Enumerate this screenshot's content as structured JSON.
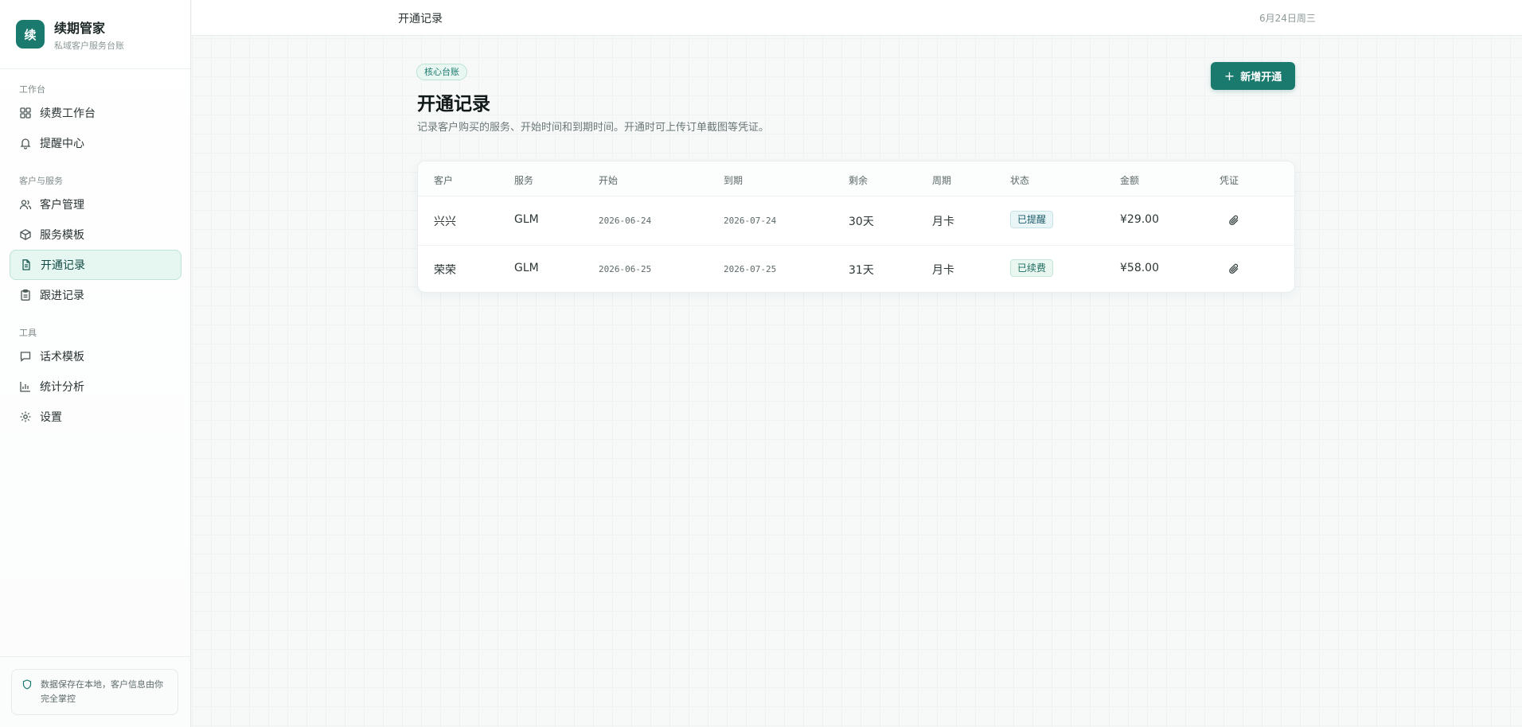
{
  "brand": {
    "logo_char": "续",
    "name": "续期管家",
    "subtitle": "私域客户服务台账"
  },
  "sidebar": {
    "sections": [
      "工作台",
      "客户与服务",
      "工具"
    ],
    "items": [
      {
        "label": "续费工作台",
        "icon": "grid-icon"
      },
      {
        "label": "提醒中心",
        "icon": "bell-icon"
      },
      {
        "label": "客户管理",
        "icon": "users-icon"
      },
      {
        "label": "服务模板",
        "icon": "box-icon"
      },
      {
        "label": "开通记录",
        "icon": "document-icon",
        "active": true
      },
      {
        "label": "跟进记录",
        "icon": "clipboard-icon"
      },
      {
        "label": "话术模板",
        "icon": "chat-icon"
      },
      {
        "label": "统计分析",
        "icon": "bar-chart-icon"
      },
      {
        "label": "设置",
        "icon": "gear-icon"
      }
    ],
    "footer_note": "数据保存在本地，客户信息由你完全掌控"
  },
  "topbar": {
    "title": "开通记录",
    "date": "6月24日周三"
  },
  "page": {
    "badge": "核心台账",
    "title": "开通记录",
    "description": "记录客户购买的服务、开始时间和到期时间。开通时可上传订单截图等凭证。",
    "add_button": "新增开通"
  },
  "table": {
    "columns": [
      "客户",
      "服务",
      "开始",
      "到期",
      "剩余",
      "周期",
      "状态",
      "金额",
      "凭证"
    ],
    "rows": [
      {
        "customer": "兴兴",
        "service": "GLM",
        "start": "2026-06-24",
        "end": "2026-07-24",
        "remaining": "30天",
        "cycle": "月卡",
        "status": "已提醒",
        "amount": "¥29.00"
      },
      {
        "customer": "荣荣",
        "service": "GLM",
        "start": "2026-06-25",
        "end": "2026-07-25",
        "remaining": "31天",
        "cycle": "月卡",
        "status": "已续费",
        "amount": "¥58.00"
      }
    ]
  },
  "colors": {
    "accent": "#1b7a6e",
    "active_bg": "#e6f6f1"
  }
}
